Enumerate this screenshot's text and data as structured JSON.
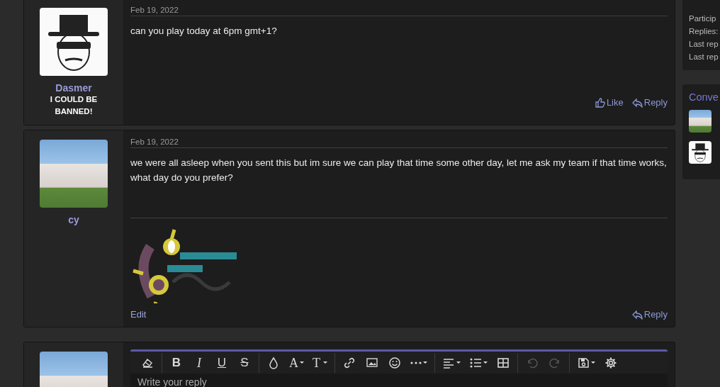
{
  "posts": [
    {
      "author": "Dasmer",
      "avatar": {
        "kind": "sketch"
      },
      "banner": "I COULD BE BANNED!",
      "date": "Feb 19, 2022",
      "body": "can you play today at 6pm gmt+1?",
      "signature": false,
      "actions_right": [
        {
          "kind": "like",
          "label": "Like"
        },
        {
          "kind": "reply",
          "label": "Reply"
        }
      ]
    },
    {
      "author": "cy",
      "avatar": {
        "kind": "photo"
      },
      "date": "Feb 19, 2022",
      "body": "we were all asleep when you sent this but im sure we can play that time some other day, let me ask my team if that time works, what day do you prefer?",
      "signature": true,
      "actions_left": [
        {
          "kind": "edit",
          "label": "Edit"
        }
      ],
      "actions_right": [
        {
          "kind": "reply",
          "label": "Reply"
        }
      ]
    }
  ],
  "editor": {
    "avatar": {
      "kind": "photo"
    },
    "placeholder": "Write your reply",
    "toolbar": [
      [
        {
          "kind": "clear",
          "disabled": false
        }
      ],
      [
        {
          "kind": "bold",
          "label": "B",
          "disabled": false
        },
        {
          "kind": "italic",
          "label": "I",
          "disabled": false
        },
        {
          "kind": "underline",
          "label": "U",
          "disabled": false
        },
        {
          "kind": "strike",
          "label": "S",
          "disabled": false
        }
      ],
      [
        {
          "kind": "color",
          "disabled": false
        },
        {
          "kind": "font",
          "label": "A",
          "disabled": false
        },
        {
          "kind": "size",
          "label": "T",
          "disabled": false
        }
      ],
      [
        {
          "kind": "link",
          "disabled": false
        },
        {
          "kind": "image",
          "disabled": false
        },
        {
          "kind": "emoji",
          "disabled": false
        },
        {
          "kind": "more",
          "disabled": false
        }
      ],
      [
        {
          "kind": "align",
          "disabled": false
        },
        {
          "kind": "list",
          "disabled": false
        },
        {
          "kind": "table",
          "disabled": false
        }
      ],
      [
        {
          "kind": "undo",
          "disabled": true
        },
        {
          "kind": "redo",
          "disabled": true
        }
      ],
      [
        {
          "kind": "drafts",
          "disabled": false
        },
        {
          "kind": "settings",
          "disabled": false
        }
      ]
    ]
  },
  "sidebar": {
    "info": [
      "Particip",
      "Replies:",
      "Last rep",
      "Last rep"
    ],
    "participants_title": "Conve",
    "participants": [
      {
        "avatar": {
          "kind": "photo"
        }
      },
      {
        "avatar": {
          "kind": "sketch"
        }
      }
    ]
  }
}
